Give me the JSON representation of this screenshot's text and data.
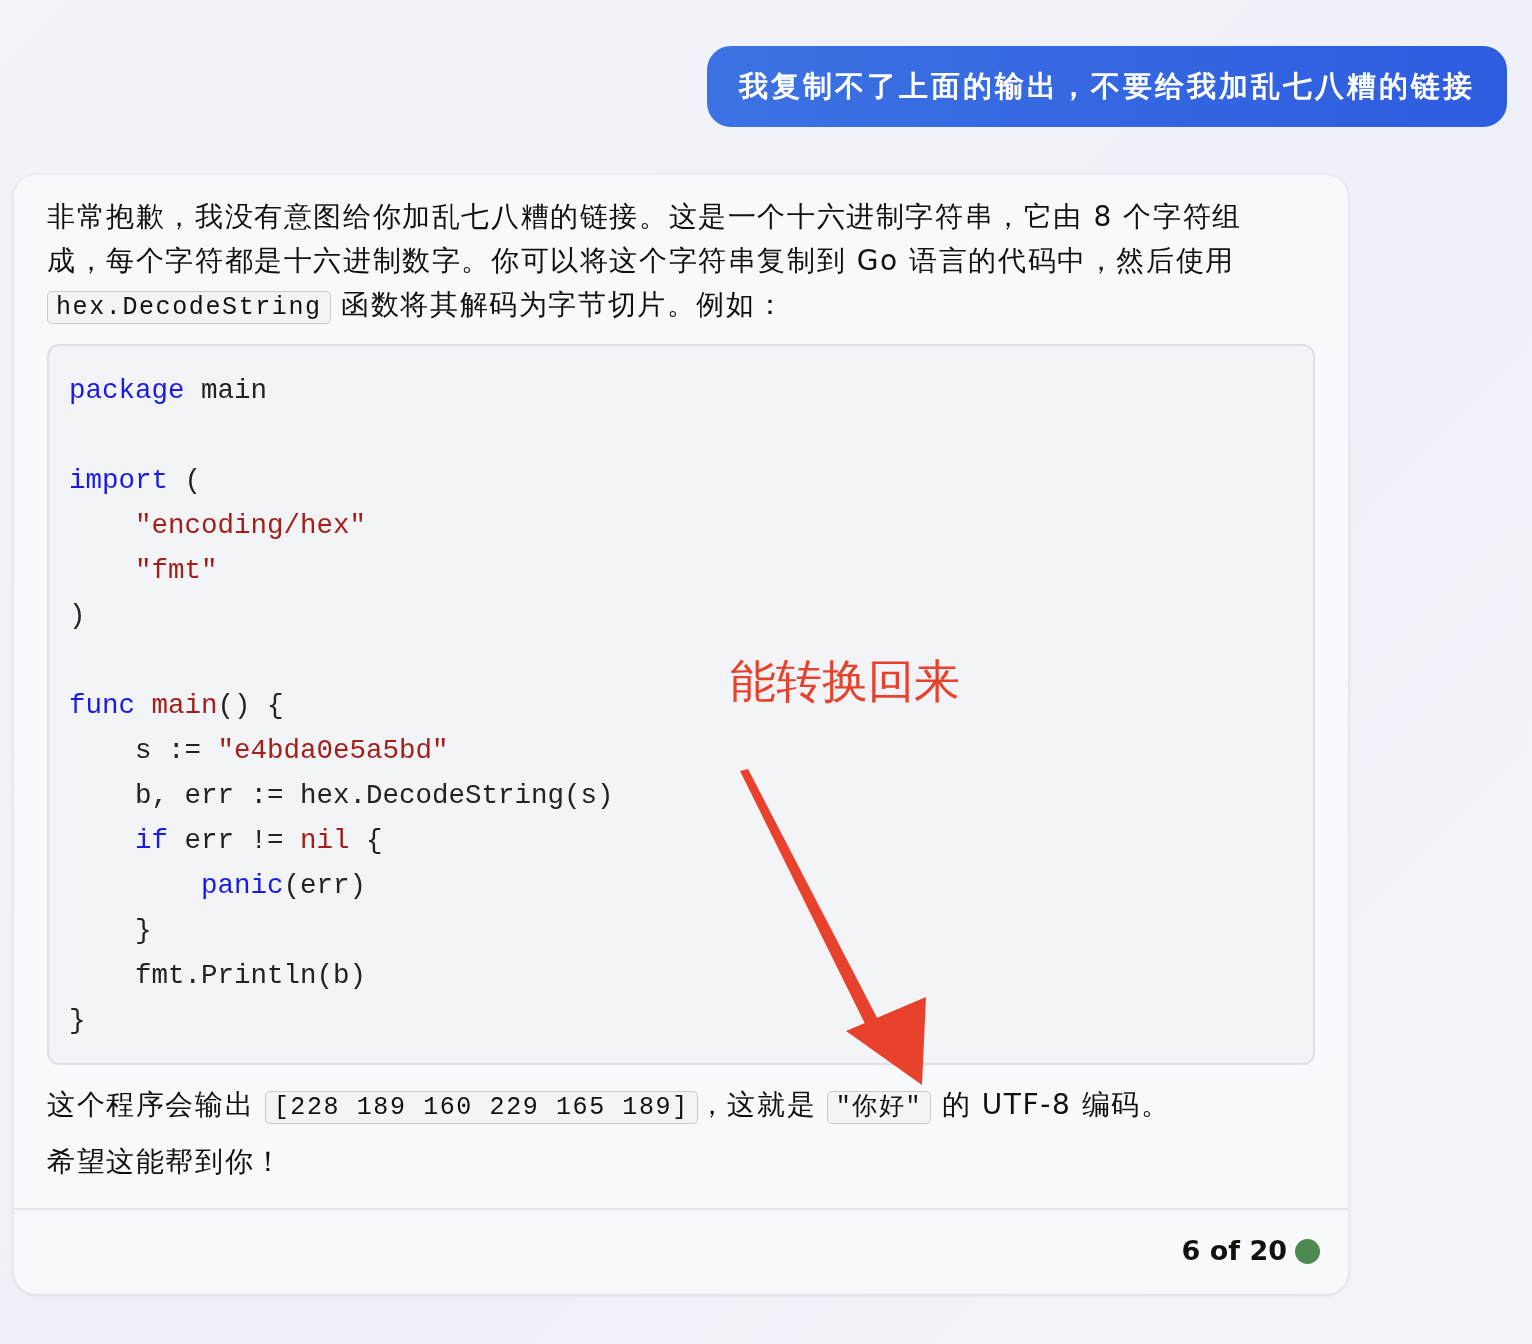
{
  "user_message": "我复制不了上面的输出，不要给我加乱七八糟的链接",
  "reply": {
    "paragraphs": [
      [
        {
          "kind": "text",
          "text": "非常抱歉，我没有意图给你加乱七八糟的链接。这是一个十六进制字符串，它由 8 个字符组成，每个字符都是十六进制数字。你可以将这个字符串复制到 Go 语言的代码中，然后使用 "
        },
        {
          "kind": "code",
          "text": "hex.DecodeString"
        },
        {
          "kind": "text",
          "text": " 函数将其解码为字节切片。例如："
        }
      ]
    ],
    "code_block": [
      {
        "kind": "code",
        "tokens": [
          {
            "kind": "keyword",
            "text": "package"
          },
          {
            "kind": "plain",
            "text": " main"
          }
        ]
      },
      {
        "kind": "blank"
      },
      {
        "kind": "code",
        "tokens": [
          {
            "kind": "keyword",
            "text": "import"
          },
          {
            "kind": "plain",
            "text": " ("
          }
        ]
      },
      {
        "kind": "code",
        "tokens": [
          {
            "kind": "string",
            "text": "    \"encoding/hex\""
          }
        ]
      },
      {
        "kind": "code",
        "tokens": [
          {
            "kind": "string",
            "text": "    \"fmt\""
          }
        ]
      },
      {
        "kind": "code",
        "tokens": [
          {
            "kind": "plain",
            "text": ")"
          }
        ]
      },
      {
        "kind": "blank"
      },
      {
        "kind": "code",
        "tokens": [
          {
            "kind": "keyword",
            "text": "func"
          },
          {
            "kind": "name",
            "text": " main"
          },
          {
            "kind": "plain",
            "text": "() {"
          }
        ]
      },
      {
        "kind": "code",
        "tokens": [
          {
            "kind": "plain",
            "text": "    s := "
          },
          {
            "kind": "string",
            "text": "\"e4bda0e5a5bd\""
          }
        ]
      },
      {
        "kind": "code",
        "tokens": [
          {
            "kind": "plain",
            "text": "    b, err := hex.DecodeString(s)"
          }
        ]
      },
      {
        "kind": "code",
        "tokens": [
          {
            "kind": "keyword",
            "text": "    if"
          },
          {
            "kind": "plain",
            "text": " err != "
          },
          {
            "kind": "name",
            "text": "nil"
          },
          {
            "kind": "plain",
            "text": " {"
          }
        ]
      },
      {
        "kind": "code",
        "tokens": [
          {
            "kind": "keyword",
            "text": "        panic"
          },
          {
            "kind": "plain",
            "text": "(err)"
          }
        ]
      },
      {
        "kind": "code",
        "tokens": [
          {
            "kind": "plain",
            "text": "    }"
          }
        ]
      },
      {
        "kind": "code",
        "tokens": [
          {
            "kind": "plain",
            "text": "    fmt.Println(b)"
          }
        ]
      },
      {
        "kind": "code",
        "tokens": [
          {
            "kind": "plain",
            "text": "}"
          }
        ]
      }
    ],
    "after": [
      [
        {
          "kind": "text",
          "text": "这个程序会输出 "
        },
        {
          "kind": "code",
          "text": "[228 189 160 229 165 189]"
        },
        {
          "kind": "text",
          "text": "，这就是 "
        },
        {
          "kind": "code",
          "text": "\"你好\""
        },
        {
          "kind": "text",
          "text": " 的 UTF-8 编码。"
        }
      ],
      [
        {
          "kind": "text",
          "text": "希望这能帮到你！"
        }
      ]
    ],
    "counter": "6 of 20"
  },
  "annotation": {
    "text": "能转换回来"
  }
}
